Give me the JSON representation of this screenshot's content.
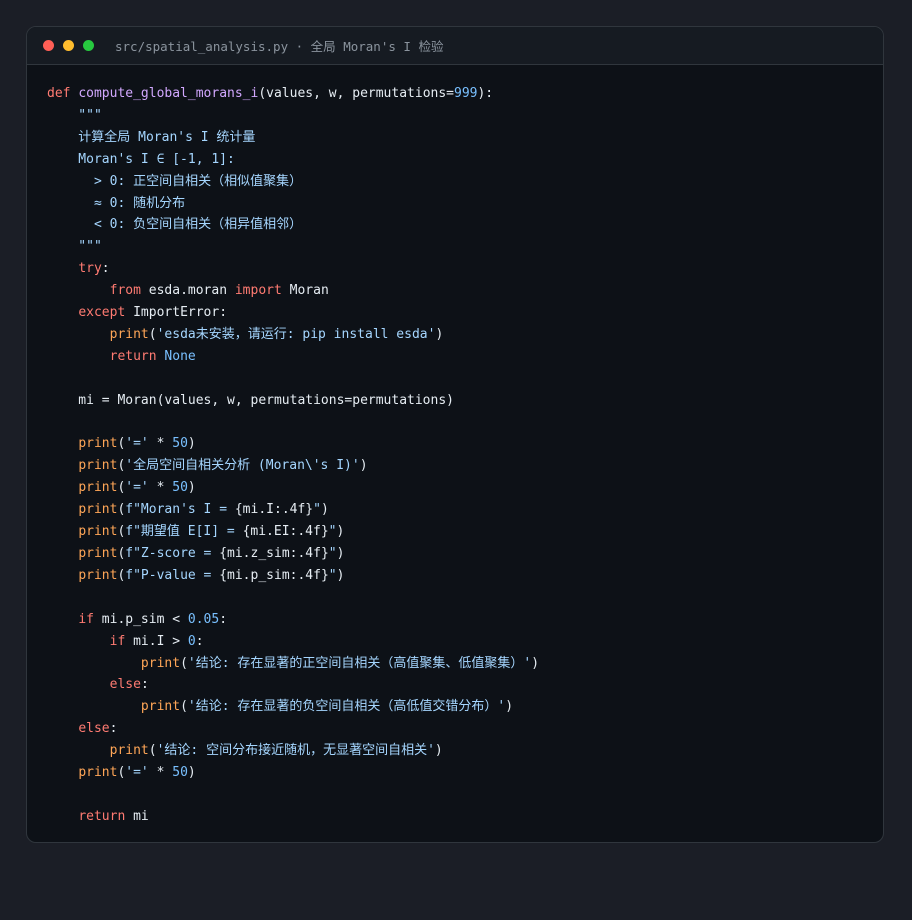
{
  "window": {
    "title": "src/spatial_analysis.py · 全局 Moran's I 检验"
  },
  "code": {
    "lines": [
      [
        {
          "t": "def ",
          "c": "kw"
        },
        {
          "t": "compute_global_morans_i",
          "c": "fn"
        },
        {
          "t": "(values, w, permutations=",
          "c": "plain"
        },
        {
          "t": "999",
          "c": "num"
        },
        {
          "t": "):",
          "c": "plain"
        }
      ],
      [
        {
          "t": "    \"\"\"",
          "c": "doc"
        }
      ],
      [
        {
          "t": "    计算全局 Moran's I 统计量",
          "c": "doc"
        }
      ],
      [
        {
          "t": "    Moran's I ∈ [-1, 1]:",
          "c": "doc"
        }
      ],
      [
        {
          "t": "      > 0: 正空间自相关（相似值聚集）",
          "c": "doc"
        }
      ],
      [
        {
          "t": "      ≈ 0: 随机分布",
          "c": "doc"
        }
      ],
      [
        {
          "t": "      < 0: 负空间自相关（相异值相邻）",
          "c": "doc"
        }
      ],
      [
        {
          "t": "    \"\"\"",
          "c": "doc"
        }
      ],
      [
        {
          "t": "    ",
          "c": "plain"
        },
        {
          "t": "try",
          "c": "kw"
        },
        {
          "t": ":",
          "c": "plain"
        }
      ],
      [
        {
          "t": "        ",
          "c": "plain"
        },
        {
          "t": "from",
          "c": "kw"
        },
        {
          "t": " esda.moran ",
          "c": "plain"
        },
        {
          "t": "import",
          "c": "kw"
        },
        {
          "t": " Moran",
          "c": "plain"
        }
      ],
      [
        {
          "t": "    ",
          "c": "plain"
        },
        {
          "t": "except",
          "c": "kw"
        },
        {
          "t": " ImportError:",
          "c": "plain"
        }
      ],
      [
        {
          "t": "        ",
          "c": "plain"
        },
        {
          "t": "print",
          "c": "bi"
        },
        {
          "t": "(",
          "c": "plain"
        },
        {
          "t": "'esda未安装，请运行: pip install esda'",
          "c": "str"
        },
        {
          "t": ")",
          "c": "plain"
        }
      ],
      [
        {
          "t": "        ",
          "c": "plain"
        },
        {
          "t": "return",
          "c": "kw"
        },
        {
          "t": " ",
          "c": "plain"
        },
        {
          "t": "None",
          "c": "num"
        }
      ],
      [],
      [
        {
          "t": "    mi = Moran(values, w, permutations=permutations)",
          "c": "plain"
        }
      ],
      [],
      [
        {
          "t": "    ",
          "c": "plain"
        },
        {
          "t": "print",
          "c": "bi"
        },
        {
          "t": "(",
          "c": "plain"
        },
        {
          "t": "'='",
          "c": "str"
        },
        {
          "t": " * ",
          "c": "plain"
        },
        {
          "t": "50",
          "c": "num"
        },
        {
          "t": ")",
          "c": "plain"
        }
      ],
      [
        {
          "t": "    ",
          "c": "plain"
        },
        {
          "t": "print",
          "c": "bi"
        },
        {
          "t": "(",
          "c": "plain"
        },
        {
          "t": "'全局空间自相关分析 (Moran\\'s I)'",
          "c": "str"
        },
        {
          "t": ")",
          "c": "plain"
        }
      ],
      [
        {
          "t": "    ",
          "c": "plain"
        },
        {
          "t": "print",
          "c": "bi"
        },
        {
          "t": "(",
          "c": "plain"
        },
        {
          "t": "'='",
          "c": "str"
        },
        {
          "t": " * ",
          "c": "plain"
        },
        {
          "t": "50",
          "c": "num"
        },
        {
          "t": ")",
          "c": "plain"
        }
      ],
      [
        {
          "t": "    ",
          "c": "plain"
        },
        {
          "t": "print",
          "c": "bi"
        },
        {
          "t": "(",
          "c": "plain"
        },
        {
          "t": "f\"Moran's I = ",
          "c": "str"
        },
        {
          "t": "{mi.I:.4f}",
          "c": "plain"
        },
        {
          "t": "\"",
          "c": "str"
        },
        {
          "t": ")",
          "c": "plain"
        }
      ],
      [
        {
          "t": "    ",
          "c": "plain"
        },
        {
          "t": "print",
          "c": "bi"
        },
        {
          "t": "(",
          "c": "plain"
        },
        {
          "t": "f\"期望值 E[I] = ",
          "c": "str"
        },
        {
          "t": "{mi.EI:.4f}",
          "c": "plain"
        },
        {
          "t": "\"",
          "c": "str"
        },
        {
          "t": ")",
          "c": "plain"
        }
      ],
      [
        {
          "t": "    ",
          "c": "plain"
        },
        {
          "t": "print",
          "c": "bi"
        },
        {
          "t": "(",
          "c": "plain"
        },
        {
          "t": "f\"Z-score = ",
          "c": "str"
        },
        {
          "t": "{mi.z_sim:.4f}",
          "c": "plain"
        },
        {
          "t": "\"",
          "c": "str"
        },
        {
          "t": ")",
          "c": "plain"
        }
      ],
      [
        {
          "t": "    ",
          "c": "plain"
        },
        {
          "t": "print",
          "c": "bi"
        },
        {
          "t": "(",
          "c": "plain"
        },
        {
          "t": "f\"P-value = ",
          "c": "str"
        },
        {
          "t": "{mi.p_sim:.4f}",
          "c": "plain"
        },
        {
          "t": "\"",
          "c": "str"
        },
        {
          "t": ")",
          "c": "plain"
        }
      ],
      [],
      [
        {
          "t": "    ",
          "c": "plain"
        },
        {
          "t": "if",
          "c": "kw"
        },
        {
          "t": " mi.p_sim < ",
          "c": "plain"
        },
        {
          "t": "0.05",
          "c": "num"
        },
        {
          "t": ":",
          "c": "plain"
        }
      ],
      [
        {
          "t": "        ",
          "c": "plain"
        },
        {
          "t": "if",
          "c": "kw"
        },
        {
          "t": " mi.I > ",
          "c": "plain"
        },
        {
          "t": "0",
          "c": "num"
        },
        {
          "t": ":",
          "c": "plain"
        }
      ],
      [
        {
          "t": "            ",
          "c": "plain"
        },
        {
          "t": "print",
          "c": "bi"
        },
        {
          "t": "(",
          "c": "plain"
        },
        {
          "t": "'结论: 存在显著的正空间自相关（高值聚集、低值聚集）'",
          "c": "str"
        },
        {
          "t": ")",
          "c": "plain"
        }
      ],
      [
        {
          "t": "        ",
          "c": "plain"
        },
        {
          "t": "else",
          "c": "kw"
        },
        {
          "t": ":",
          "c": "plain"
        }
      ],
      [
        {
          "t": "            ",
          "c": "plain"
        },
        {
          "t": "print",
          "c": "bi"
        },
        {
          "t": "(",
          "c": "plain"
        },
        {
          "t": "'结论: 存在显著的负空间自相关（高低值交错分布）'",
          "c": "str"
        },
        {
          "t": ")",
          "c": "plain"
        }
      ],
      [
        {
          "t": "    ",
          "c": "plain"
        },
        {
          "t": "else",
          "c": "kw"
        },
        {
          "t": ":",
          "c": "plain"
        }
      ],
      [
        {
          "t": "        ",
          "c": "plain"
        },
        {
          "t": "print",
          "c": "bi"
        },
        {
          "t": "(",
          "c": "plain"
        },
        {
          "t": "'结论: 空间分布接近随机，无显著空间自相关'",
          "c": "str"
        },
        {
          "t": ")",
          "c": "plain"
        }
      ],
      [
        {
          "t": "    ",
          "c": "plain"
        },
        {
          "t": "print",
          "c": "bi"
        },
        {
          "t": "(",
          "c": "plain"
        },
        {
          "t": "'='",
          "c": "str"
        },
        {
          "t": " * ",
          "c": "plain"
        },
        {
          "t": "50",
          "c": "num"
        },
        {
          "t": ")",
          "c": "plain"
        }
      ],
      [],
      [
        {
          "t": "    ",
          "c": "plain"
        },
        {
          "t": "return",
          "c": "kw"
        },
        {
          "t": " mi",
          "c": "plain"
        }
      ]
    ]
  }
}
